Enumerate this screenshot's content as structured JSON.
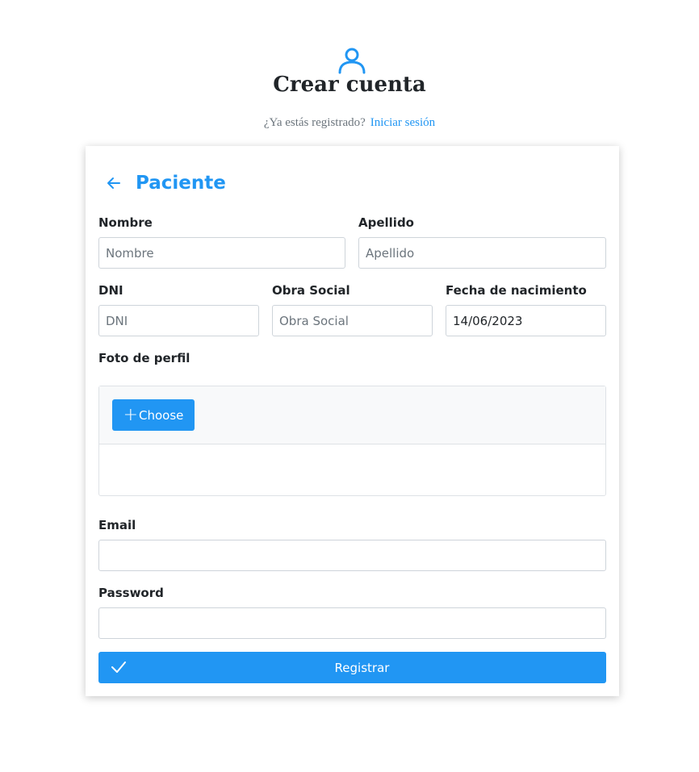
{
  "header": {
    "title": "Crear cuenta",
    "question": "¿Ya estás registrado?",
    "login_link": "Iniciar sesión"
  },
  "card": {
    "title": "Paciente"
  },
  "fields": {
    "nombre": {
      "label": "Nombre",
      "placeholder": "Nombre",
      "value": ""
    },
    "apellido": {
      "label": "Apellido",
      "placeholder": "Apellido",
      "value": ""
    },
    "dni": {
      "label": "DNI",
      "placeholder": "DNI",
      "value": ""
    },
    "obra_social": {
      "label": "Obra Social",
      "placeholder": "Obra Social",
      "value": ""
    },
    "fecha_nacimiento": {
      "label": "Fecha de nacimiento",
      "value": "14/06/2023"
    },
    "foto": {
      "label": "Foto de perfil",
      "choose_label": "Choose"
    },
    "email": {
      "label": "Email",
      "value": ""
    },
    "password": {
      "label": "Password",
      "value": ""
    }
  },
  "submit": {
    "label": "Registrar"
  },
  "colors": {
    "accent": "#2196f3",
    "text": "#212529",
    "muted": "#6c757d",
    "border": "#ced4da"
  },
  "icons": {
    "header": "user-icon",
    "back": "arrow-left-icon",
    "upload": "plus-icon",
    "submit": "check-icon"
  }
}
